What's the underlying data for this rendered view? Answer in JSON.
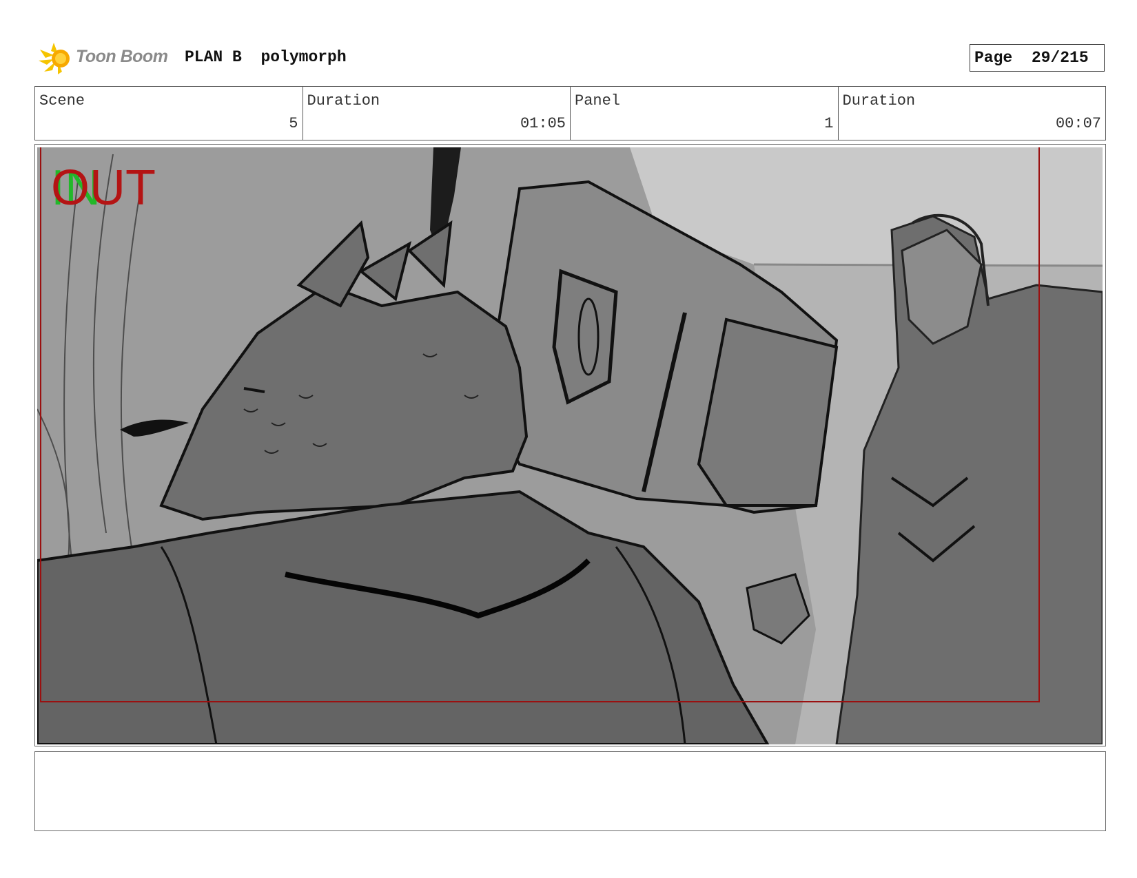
{
  "header": {
    "logo_text": "Toon Boom",
    "project_name": "PLAN B",
    "project_subtitle": "polymorph",
    "page_label": "Page",
    "page_value": "29/215"
  },
  "info": {
    "scene_label": "Scene",
    "scene_value": "5",
    "scene_duration_label": "Duration",
    "scene_duration_value": "01:05",
    "panel_label": "Panel",
    "panel_value": "1",
    "panel_duration_label": "Duration",
    "panel_duration_value": "00:07"
  },
  "frame": {
    "in_marker": "IN",
    "out_marker": "OUT",
    "in_color": "#22b82a",
    "out_color": "#b41414",
    "safe_border_color": "#9a1010"
  },
  "notes": {
    "text": ""
  }
}
